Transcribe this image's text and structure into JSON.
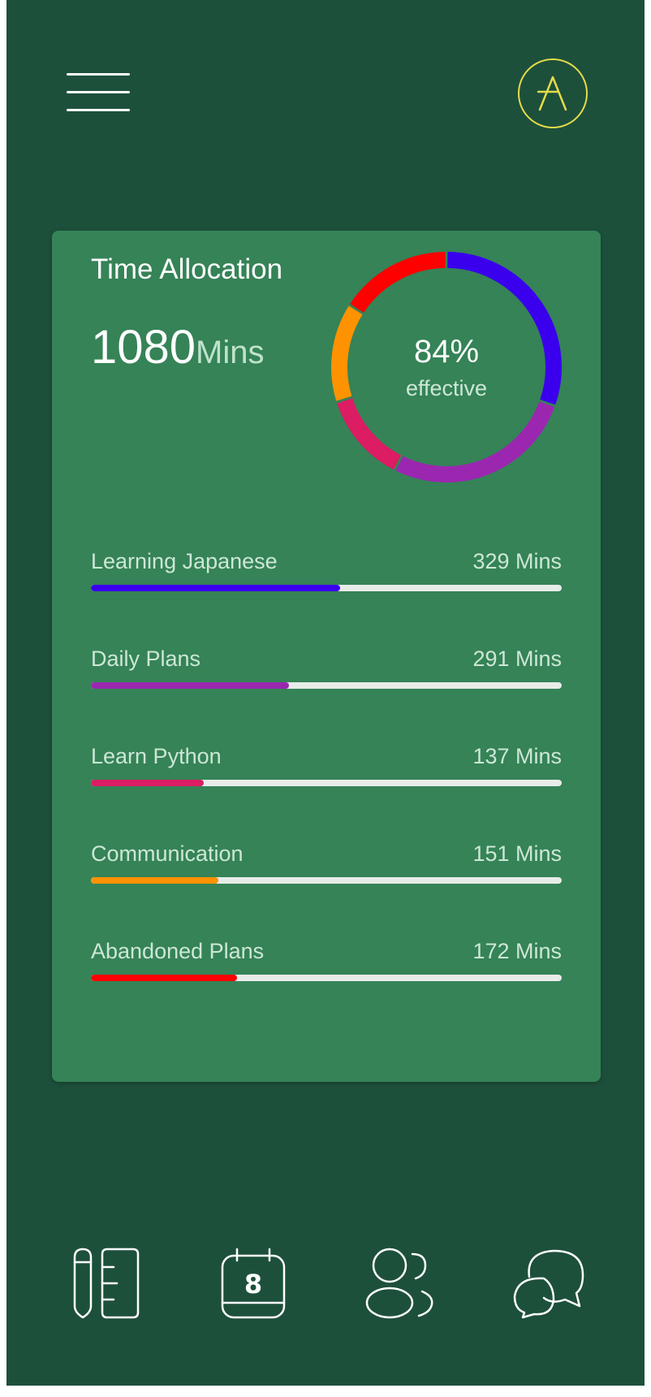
{
  "header": {
    "menu_icon": "hamburger-menu-icon",
    "avatar_letter": "A",
    "avatar_color": "#e4dc4a"
  },
  "card": {
    "title": "Time Allocation",
    "total_value": "1080",
    "total_unit": "Mins",
    "donut": {
      "center_value": "84%",
      "center_label": "effective",
      "segments": [
        {
          "name": "Learning Japanese",
          "value": 329,
          "color": "#3a00ee"
        },
        {
          "name": "Daily Plans",
          "value": 291,
          "color": "#9b27b0"
        },
        {
          "name": "Learn Python",
          "value": 137,
          "color": "#dc1c63"
        },
        {
          "name": "Communication",
          "value": 151,
          "color": "#ff9200"
        },
        {
          "name": "Abandoned Plans",
          "value": 172,
          "color": "#ff0000"
        }
      ]
    },
    "rows": [
      {
        "label": "Learning Japanese",
        "value": "329 Mins",
        "progress": 0.53,
        "color": "#3a00ee"
      },
      {
        "label": "Daily Plans",
        "value": "291 Mins",
        "progress": 0.42,
        "color": "#9b27b0"
      },
      {
        "label": "Learn Python",
        "value": "137 Mins",
        "progress": 0.24,
        "color": "#dc1c63"
      },
      {
        "label": "Communication",
        "value": "151 Mins",
        "progress": 0.27,
        "color": "#ff9200"
      },
      {
        "label": "Abandoned Plans",
        "value": "172 Mins",
        "progress": 0.31,
        "color": "#ff0000"
      }
    ]
  },
  "tabbar": {
    "items": [
      {
        "icon": "notes-ruler-icon"
      },
      {
        "icon": "calendar-icon",
        "day": "8"
      },
      {
        "icon": "people-icon"
      },
      {
        "icon": "chat-bubbles-icon"
      }
    ]
  }
}
